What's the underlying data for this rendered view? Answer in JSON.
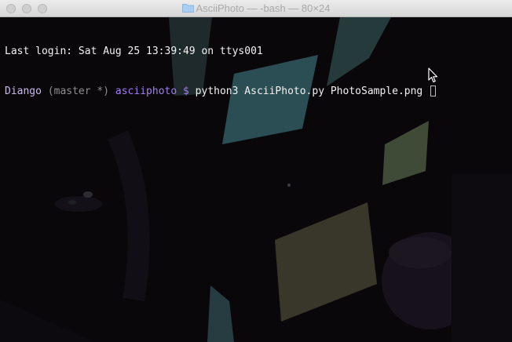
{
  "window": {
    "title": "AsciiPhoto — -bash — 80×24",
    "folder_icon": "folder-icon"
  },
  "terminal": {
    "last_login": "Last login: Sat Aug 25 13:39:49 on ttys001",
    "prompt": {
      "user": "Diango",
      "branch": "(master *)",
      "directory": "asciiphoto",
      "symbol": "$"
    },
    "command": "python3 AsciiPhoto.py PhotoSample.png"
  },
  "colors": {
    "background": "#0a070b",
    "prompt_user": "#c9b8f0",
    "prompt_branch": "#8e8e8e",
    "prompt_directory": "#a47cf0",
    "text": "#f2f2f2"
  },
  "icons": {
    "mouse_pointer": "arrow-cursor-icon"
  }
}
